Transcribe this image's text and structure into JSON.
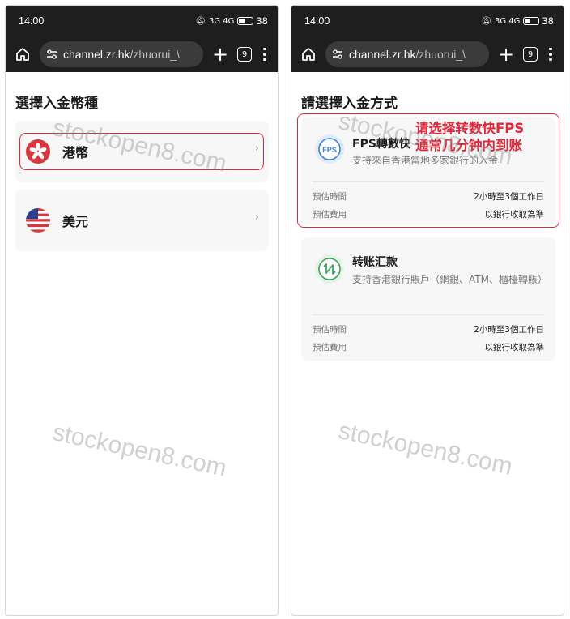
{
  "status": {
    "time": "14:00",
    "signal_icons": "3G 4G",
    "battery_pct": "38",
    "battery_level": 0.38
  },
  "browser": {
    "url_host": "channel.zr.hk",
    "url_path": "/zhuorui_\\",
    "tab_count": "9",
    "plus_label": "+"
  },
  "left": {
    "title": "選擇入金幣種",
    "currencies": [
      {
        "label": "港幣",
        "icon": "hk-flag-icon"
      },
      {
        "label": "美元",
        "icon": "us-flag-icon"
      }
    ],
    "chevron": "›"
  },
  "right": {
    "title": "請選擇入金方式",
    "annotation_line1": "请选择转数快FPS",
    "annotation_line2": "通常几分钟内到账",
    "methods": [
      {
        "icon_text": "FPS",
        "title": "FPS轉數快",
        "desc": "支持來自香港當地多家銀行的入金",
        "time_label": "預估時間",
        "time_value": "2小時至3個工作日",
        "fee_label": "預估費用",
        "fee_value": "以銀行收取為準"
      },
      {
        "icon_text": "",
        "title": "转账汇款",
        "desc": "支持香港銀行賬戶（網銀、ATM、櫃檯轉賬）",
        "time_label": "預估時間",
        "time_value": "2小時至3個工作日",
        "fee_label": "預估費用",
        "fee_value": "以銀行收取為準"
      }
    ]
  },
  "watermark": "stockopen8.com",
  "colors": {
    "highlight": "#e0283a",
    "fps_blue": "#3d7fd6",
    "transfer_green": "#3aa55a",
    "hk_red": "#d7373f"
  }
}
